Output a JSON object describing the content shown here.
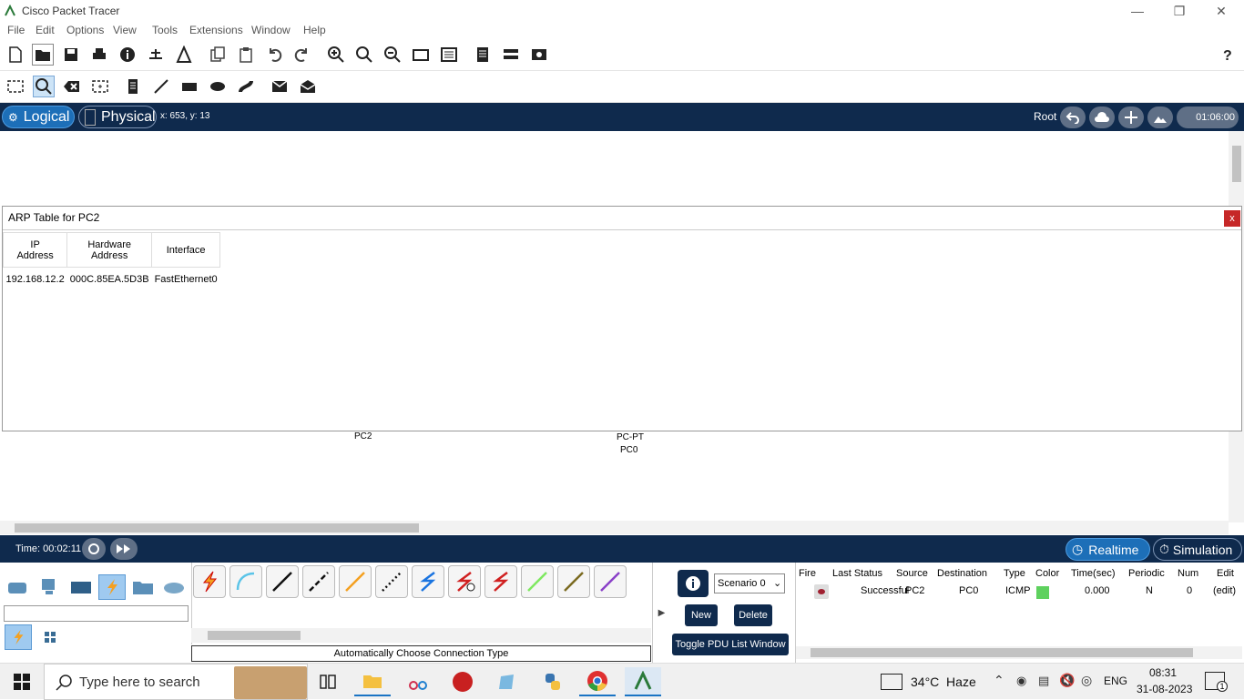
{
  "window": {
    "title": "Cisco Packet Tracer"
  },
  "menu": [
    "File",
    "Edit",
    "Options",
    "View",
    "Tools",
    "Extensions",
    "Window",
    "Help"
  ],
  "workspace": {
    "logical_label": "Logical",
    "physical_label": "Physical",
    "coords": "x: 653, y: 13",
    "root_label": "Root",
    "clock": "01:06:00"
  },
  "arp": {
    "title": "ARP Table for PC2",
    "close": "x",
    "headers": [
      "IP\nAddress",
      "Hardware\nAddress",
      "Interface"
    ],
    "rows": [
      {
        "ip": "192.168.12.2",
        "mac": "000C.85EA.5D3B",
        "iface": "FastEthernet0"
      }
    ]
  },
  "devices": {
    "pc2_label": "PC2",
    "pc0_type": "PC-PT",
    "pc0_label": "PC0"
  },
  "timebar": {
    "time": "Time: 00:02:11",
    "realtime": "Realtime",
    "simulation": "Simulation"
  },
  "bottom": {
    "connection_type_label": "Automatically Choose Connection Type",
    "search_placeholder": "",
    "scenario": "Scenario 0",
    "new_btn": "New",
    "delete_btn": "Delete",
    "toggle_btn": "Toggle PDU List Window",
    "pdu_headers": [
      "Fire",
      "Last Status",
      "Source",
      "Destination",
      "Type",
      "Color",
      "Time(sec)",
      "Periodic",
      "Num",
      "Edit"
    ],
    "pdu_row": {
      "status": "Successful",
      "source": "PC2",
      "destination": "PC0",
      "type": "ICMP",
      "time": "0.000",
      "periodic": "N",
      "num": "0",
      "edit": "(edit)",
      "color": "#5ed15e"
    }
  },
  "taskbar": {
    "search_placeholder": "Type here to search",
    "weather": "34°C  Haze",
    "lang": "ENG",
    "time": "08:31",
    "date": "31-08-2023",
    "notif_count": "1"
  },
  "colors": {
    "wsbar": "#0f2a4d",
    "accent": "#1a74c4"
  }
}
